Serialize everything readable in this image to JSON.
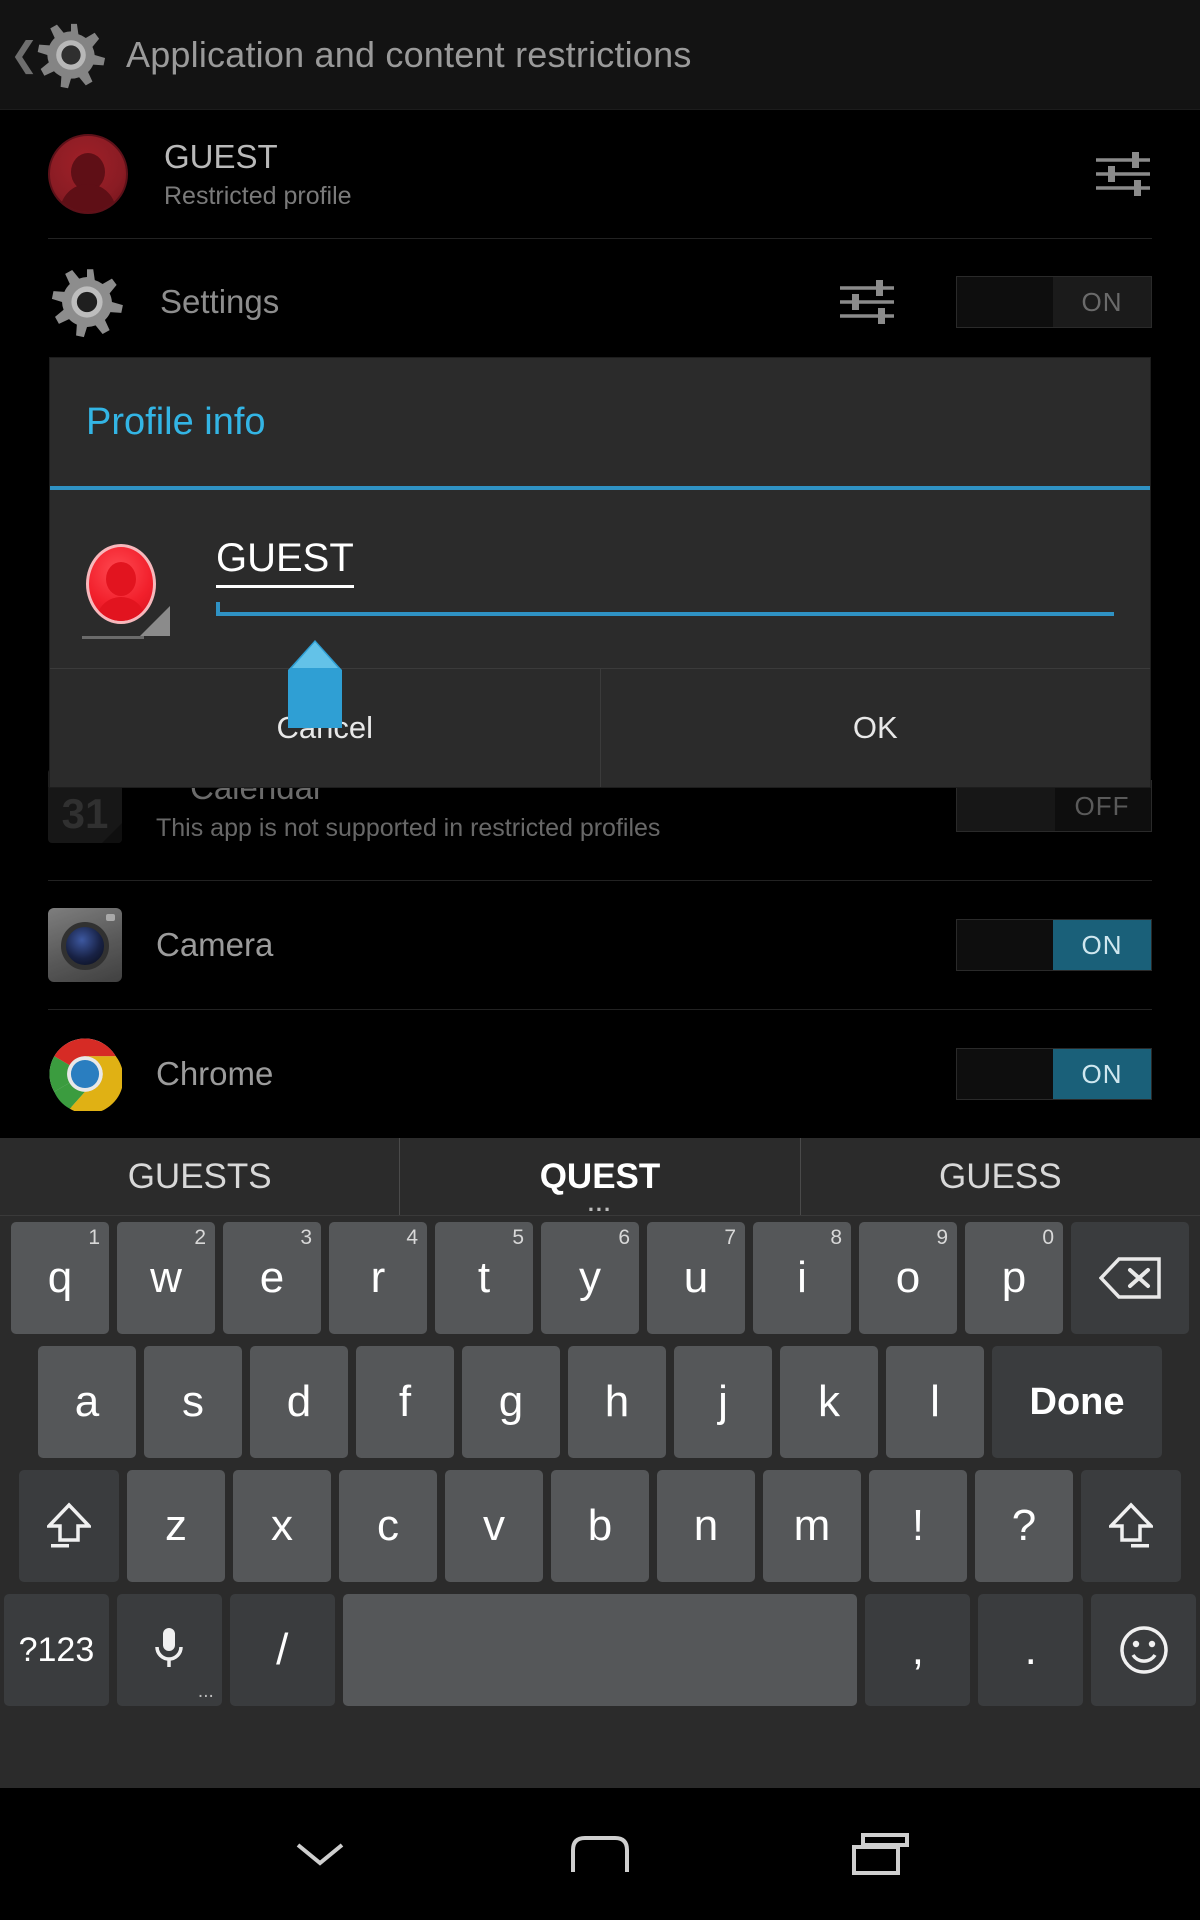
{
  "actionbar": {
    "title": "Application and content restrictions",
    "back_icon": "back-chevron-icon",
    "app_icon": "settings-gear-icon"
  },
  "profile": {
    "name": "GUEST",
    "subtitle": "Restricted profile",
    "settings_icon": "sliders-icon"
  },
  "settings_row": {
    "label": "Settings",
    "sliders_icon": "sliders-icon",
    "toggle_label": "ON",
    "toggle_state": "on"
  },
  "dialog": {
    "title": "Profile info",
    "name_value": "GUEST",
    "avatar_icon": "profile-avatar-icon",
    "picker_icon": "image-picker-triangle-icon",
    "cancel_label": "Cancel",
    "ok_label": "OK",
    "accent_color": "#33b5e5",
    "rule_color": "#2f92c4",
    "handle_color": "#2f9fd4"
  },
  "apps": [
    {
      "name": "Calendar",
      "subtitle": "This app is not supported in restricted profiles",
      "icon": "calendar-icon",
      "icon_day": "31",
      "toggle_label": "OFF",
      "toggle_state": "off"
    },
    {
      "name": "Camera",
      "subtitle": "",
      "icon": "camera-icon",
      "toggle_label": "ON",
      "toggle_state": "on"
    },
    {
      "name": "Chrome",
      "subtitle": "",
      "icon": "chrome-icon",
      "toggle_label": "ON",
      "toggle_state": "on"
    }
  ],
  "keyboard": {
    "suggestions": [
      {
        "text": "GUESTS",
        "active": false
      },
      {
        "text": "QUEST",
        "active": true
      },
      {
        "text": "GUESS",
        "active": false
      }
    ],
    "row1": [
      {
        "label": "q",
        "hint": "1"
      },
      {
        "label": "w",
        "hint": "2"
      },
      {
        "label": "e",
        "hint": "3"
      },
      {
        "label": "r",
        "hint": "4"
      },
      {
        "label": "t",
        "hint": "5"
      },
      {
        "label": "y",
        "hint": "6"
      },
      {
        "label": "u",
        "hint": "7"
      },
      {
        "label": "i",
        "hint": "8"
      },
      {
        "label": "o",
        "hint": "9"
      },
      {
        "label": "p",
        "hint": "0"
      }
    ],
    "row2": [
      {
        "label": "a"
      },
      {
        "label": "s"
      },
      {
        "label": "d"
      },
      {
        "label": "f"
      },
      {
        "label": "g"
      },
      {
        "label": "h"
      },
      {
        "label": "j"
      },
      {
        "label": "k"
      },
      {
        "label": "l"
      }
    ],
    "row3": [
      {
        "label": "z"
      },
      {
        "label": "x"
      },
      {
        "label": "c"
      },
      {
        "label": "v"
      },
      {
        "label": "b"
      },
      {
        "label": "n"
      },
      {
        "label": "m"
      },
      {
        "label": "!"
      },
      {
        "label": "?"
      }
    ],
    "backspace_icon": "backspace-icon",
    "done_label": "Done",
    "shift_left_icon": "shift-icon",
    "shift_right_icon": "shift-icon",
    "symbols_label": "?123",
    "mic_icon": "microphone-icon",
    "slash_label": "/",
    "space_label": "",
    "comma_label": ",",
    "period_label": ".",
    "emoji_icon": "emoji-icon"
  },
  "navbar": {
    "back_icon": "nav-down-chevron-icon",
    "home_icon": "nav-home-icon",
    "recents_icon": "nav-recents-icon"
  }
}
